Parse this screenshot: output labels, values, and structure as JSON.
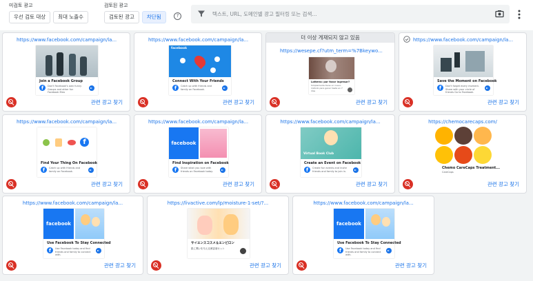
{
  "toolbar": {
    "unreviewed_caption": "미검토 광고",
    "reviewed_caption": "검토된 광고",
    "priority_label": "우선 검토 대상",
    "max_exposure_label": "최대 노출수",
    "reviewed_label": "검토된 광고",
    "blocked_label": "차단됨",
    "help_glyph": "?",
    "search_placeholder": "텍스트, URL, 도메인별 광고 필터링 또는 검색..."
  },
  "colors": {
    "accent": "#1a73e8",
    "block": "#d93025",
    "facebook": "#1877f2"
  },
  "cards": [
    {
      "url": "https://www.facebook.com/campaign/la...",
      "title": "Join a Facebook Group",
      "text": "Don't Facebook's own funny Groups and other fun Facebook Mea",
      "related": "관련 광고 찾기"
    },
    {
      "url": "https://www.facebook.com/campaign/la...",
      "title": "Connect With Your Friends",
      "text": "Catch up with friends and family on Facebook.",
      "related": "관련 광고 찾기",
      "brand": "facebook"
    },
    {
      "banner": "더 이상 게재되지 않고 있음",
      "url": "https://wesepe.cf?utm_term=%7Bkeywo...",
      "title": "Lottería: por favor ingresar?",
      "text": "Simplemente tiene un nuevo método para ganar hasta en 7 días",
      "related": "관련 광고 찾기"
    },
    {
      "url": "https://www.facebook.com/campaign/la...",
      "title": "Save the Moment on Facebook",
      "text": "Don't forget every moment. Share with your circle of friends Go to Facebook.",
      "related": "관련 광고 찾기"
    },
    {
      "url": "https://www.facebook.com/campaign/la...",
      "title": "Find Your Thing On Facebook",
      "text": "Catch up with friends and family on Facebook.",
      "related": "관련 광고 찾기"
    },
    {
      "url": "https://www.facebook.com/campaign/la...",
      "title": "Find Inspiration on Facebook",
      "text": "Share what you love with friends on Facebook today.",
      "related": "관련 광고 찾기",
      "brand": "facebook"
    },
    {
      "url": "https://www.facebook.com/campaign/la...",
      "title": "Create an Event on Facebook",
      "text": "Create fun events and invite friends and family to join in.",
      "related": "관련 광고 찾기",
      "overlay": "Virtual Book Club"
    },
    {
      "url": "https://chemocarecaps.com/",
      "title": "Chemo CareCaps Treatment...",
      "text": "CareCaps",
      "related": "관련 광고 찾기"
    },
    {
      "url": "https://www.facebook.com/campaign/la...",
      "title": "Use Facebook To Stay Connected",
      "text": "Use Facebook today and find friends and family to connect with.",
      "related": "관련 광고 찾기",
      "brand": "facebook"
    },
    {
      "url": "https://livactive.com/lp/moisture-1-set/?...",
      "title": "サイエンスコスメ＆エンビロン",
      "text": "肌に潤いを与える美容液セット",
      "related": "관련 광고 찾기"
    },
    {
      "url": "https://www.facebook.com/campaign/la...",
      "title": "Use Facebook To Stay Connected",
      "text": "Use Facebook today and find friends and family to connect with.",
      "related": "관련 광고 찾기",
      "brand": "facebook"
    }
  ]
}
